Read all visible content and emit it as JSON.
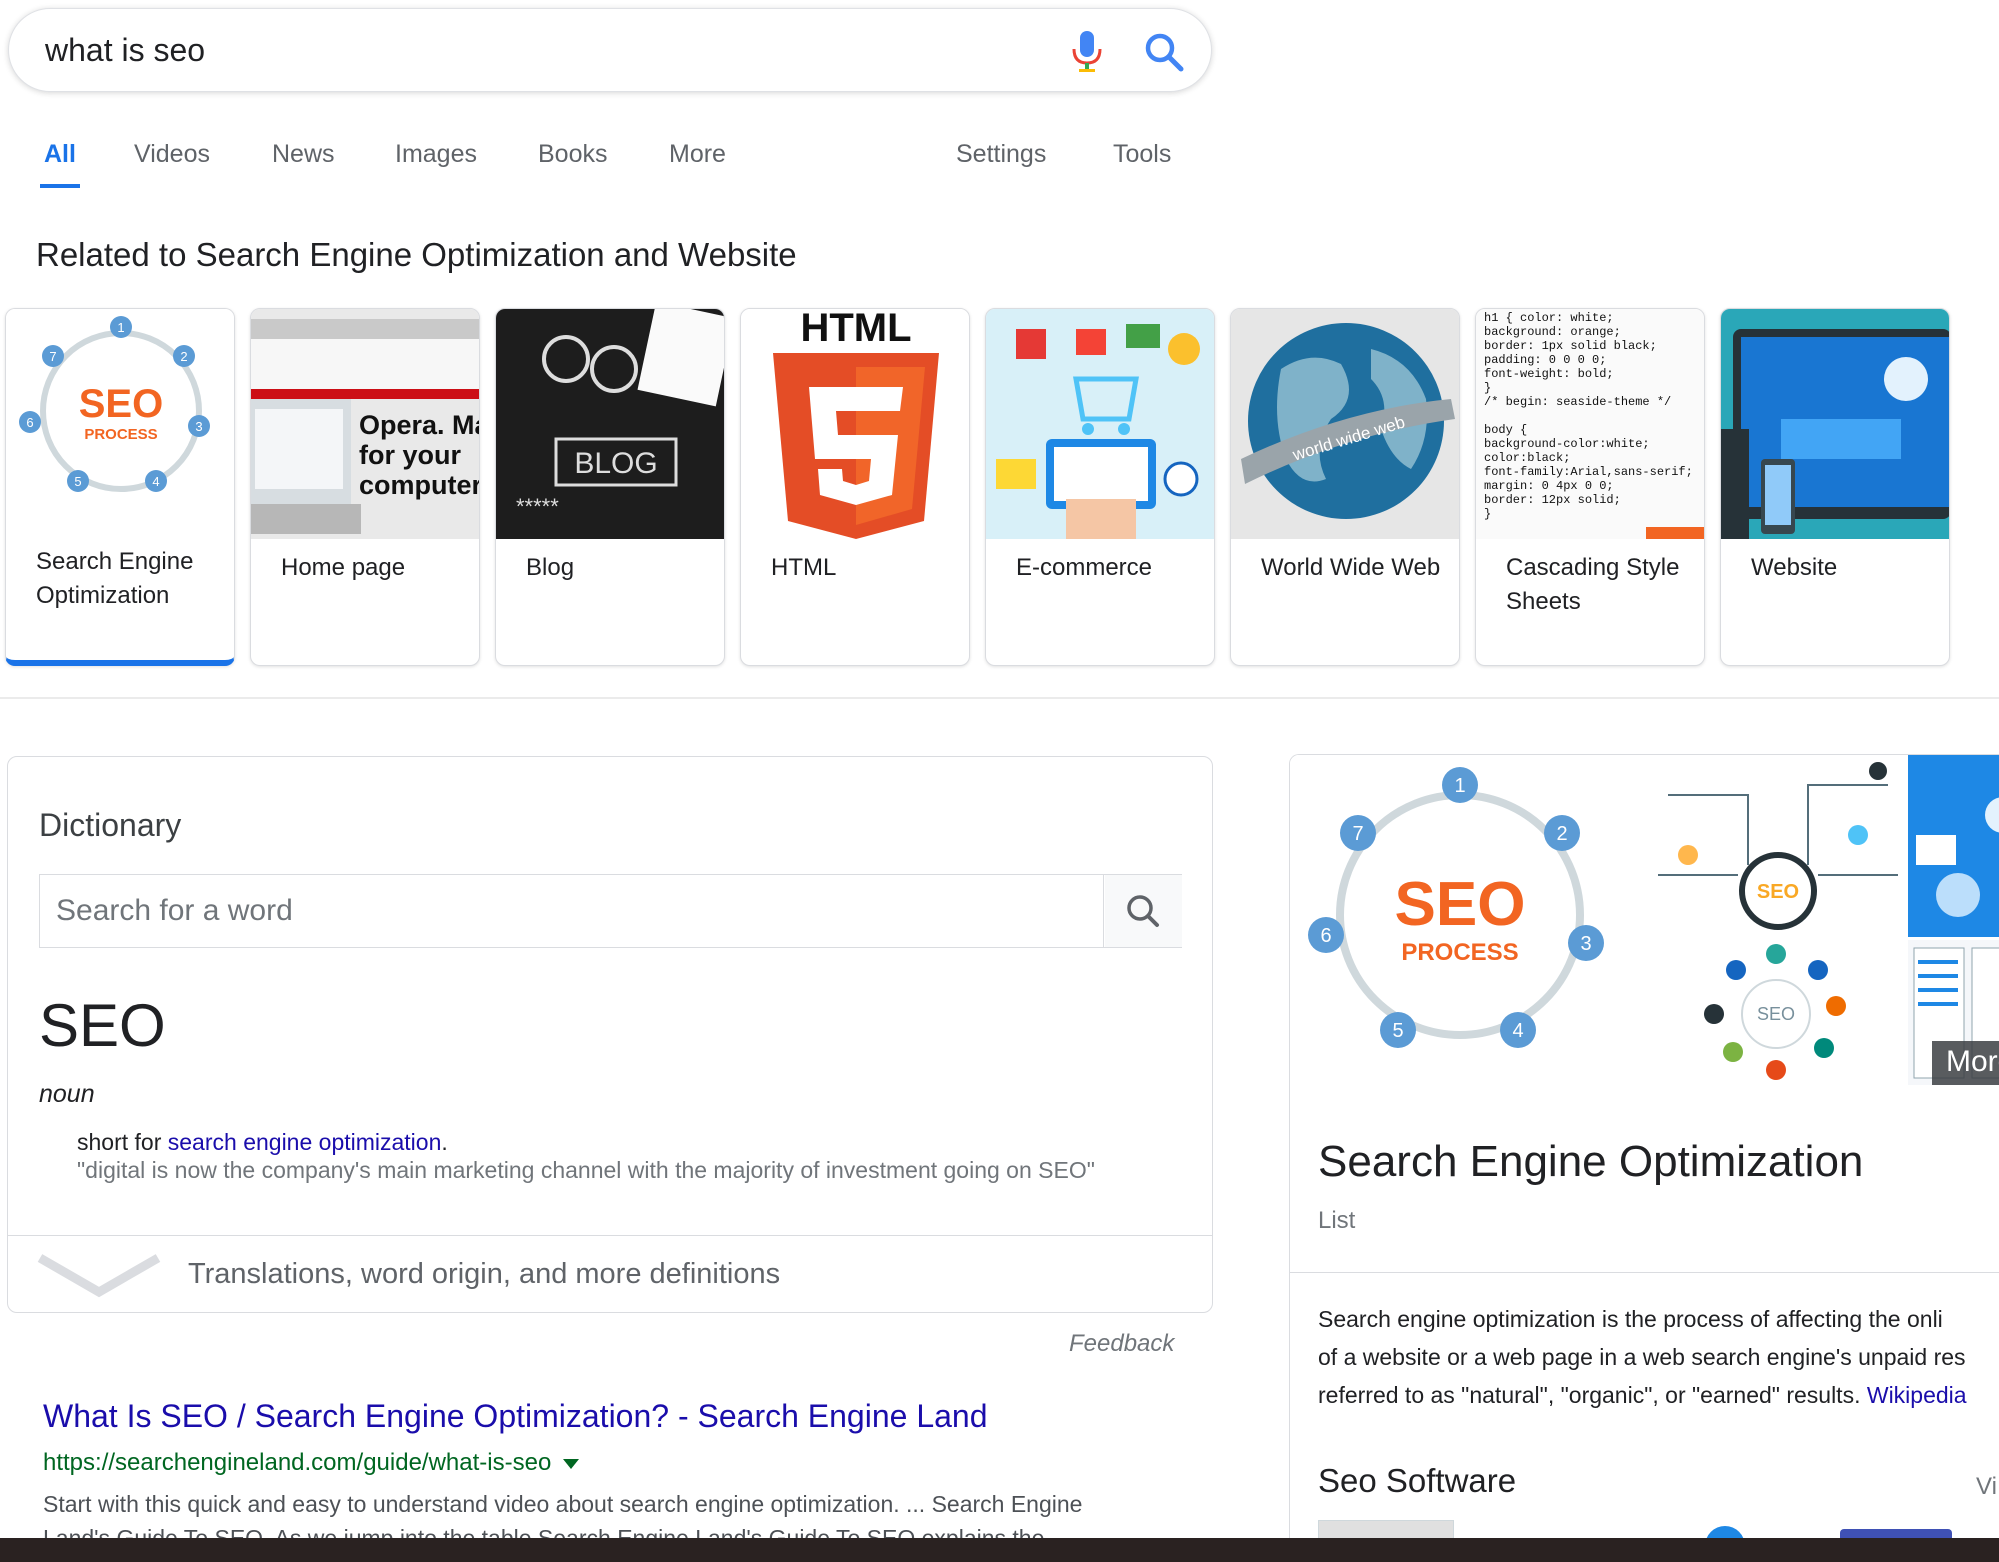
{
  "search": {
    "query": "what is seo"
  },
  "tabs": {
    "items": [
      "All",
      "Videos",
      "News",
      "Images",
      "Books",
      "More"
    ],
    "settings": "Settings",
    "tools": "Tools"
  },
  "related": {
    "title": "Related to Search Engine Optimization and Website",
    "cards": [
      {
        "label": "Search Engine Optimization",
        "thumb_text": "SEO",
        "thumb_sub": "PROCESS"
      },
      {
        "label": "Home page",
        "thumb_text": "Opera. Ma for your computer."
      },
      {
        "label": "Blog",
        "thumb_text": "BLOG"
      },
      {
        "label": "HTML",
        "thumb_text": "HTML"
      },
      {
        "label": "E-commerce"
      },
      {
        "label": "World Wide Web",
        "thumb_text": "world wide web"
      },
      {
        "label": "Cascading Style Sheets"
      },
      {
        "label": "Website"
      }
    ]
  },
  "dictionary": {
    "heading": "Dictionary",
    "search_placeholder": "Search for a word",
    "term": "SEO",
    "part_of_speech": "noun",
    "definition_prefix": "short for",
    "definition_link": "search engine optimization",
    "definition_suffix": ".",
    "example": "\"digital is now the company's main marketing channel with the majority of investment going on SEO\"",
    "more": "Translations, word origin, and more definitions"
  },
  "feedback": "Feedback",
  "result": {
    "title": "What Is SEO / Search Engine Optimization? - Search Engine Land",
    "url": "https://searchengineland.com/guide/what-is-seo",
    "snippet": "Start with this quick and easy to understand video about search engine optimization. ... Search Engine",
    "snippet2": "Land's Guide To SEO. As we jump into the table Search Engine Land's Guide To SEO explains the"
  },
  "knowledge_panel": {
    "title": "Search Engine Optimization",
    "subtitle": "List",
    "description_lines": [
      "Search engine optimization is the process of affecting the onli",
      "of a website or a web page in a web search engine's unpaid res",
      "referred to as \"natural\", \"organic\", or \"earned\" results."
    ],
    "description_link": "Wikipedia",
    "software_heading": "Seo Software",
    "view_link": "Vi",
    "more_images": "More",
    "image_text": {
      "main": "SEO",
      "sub": "PROCESS",
      "badge": "SEO"
    }
  },
  "colors": {
    "accent": "#1a73e8",
    "link": "#1a0dab",
    "url_green": "#006621",
    "seo_orange": "#f26522",
    "html_orange": "#e44d26"
  }
}
